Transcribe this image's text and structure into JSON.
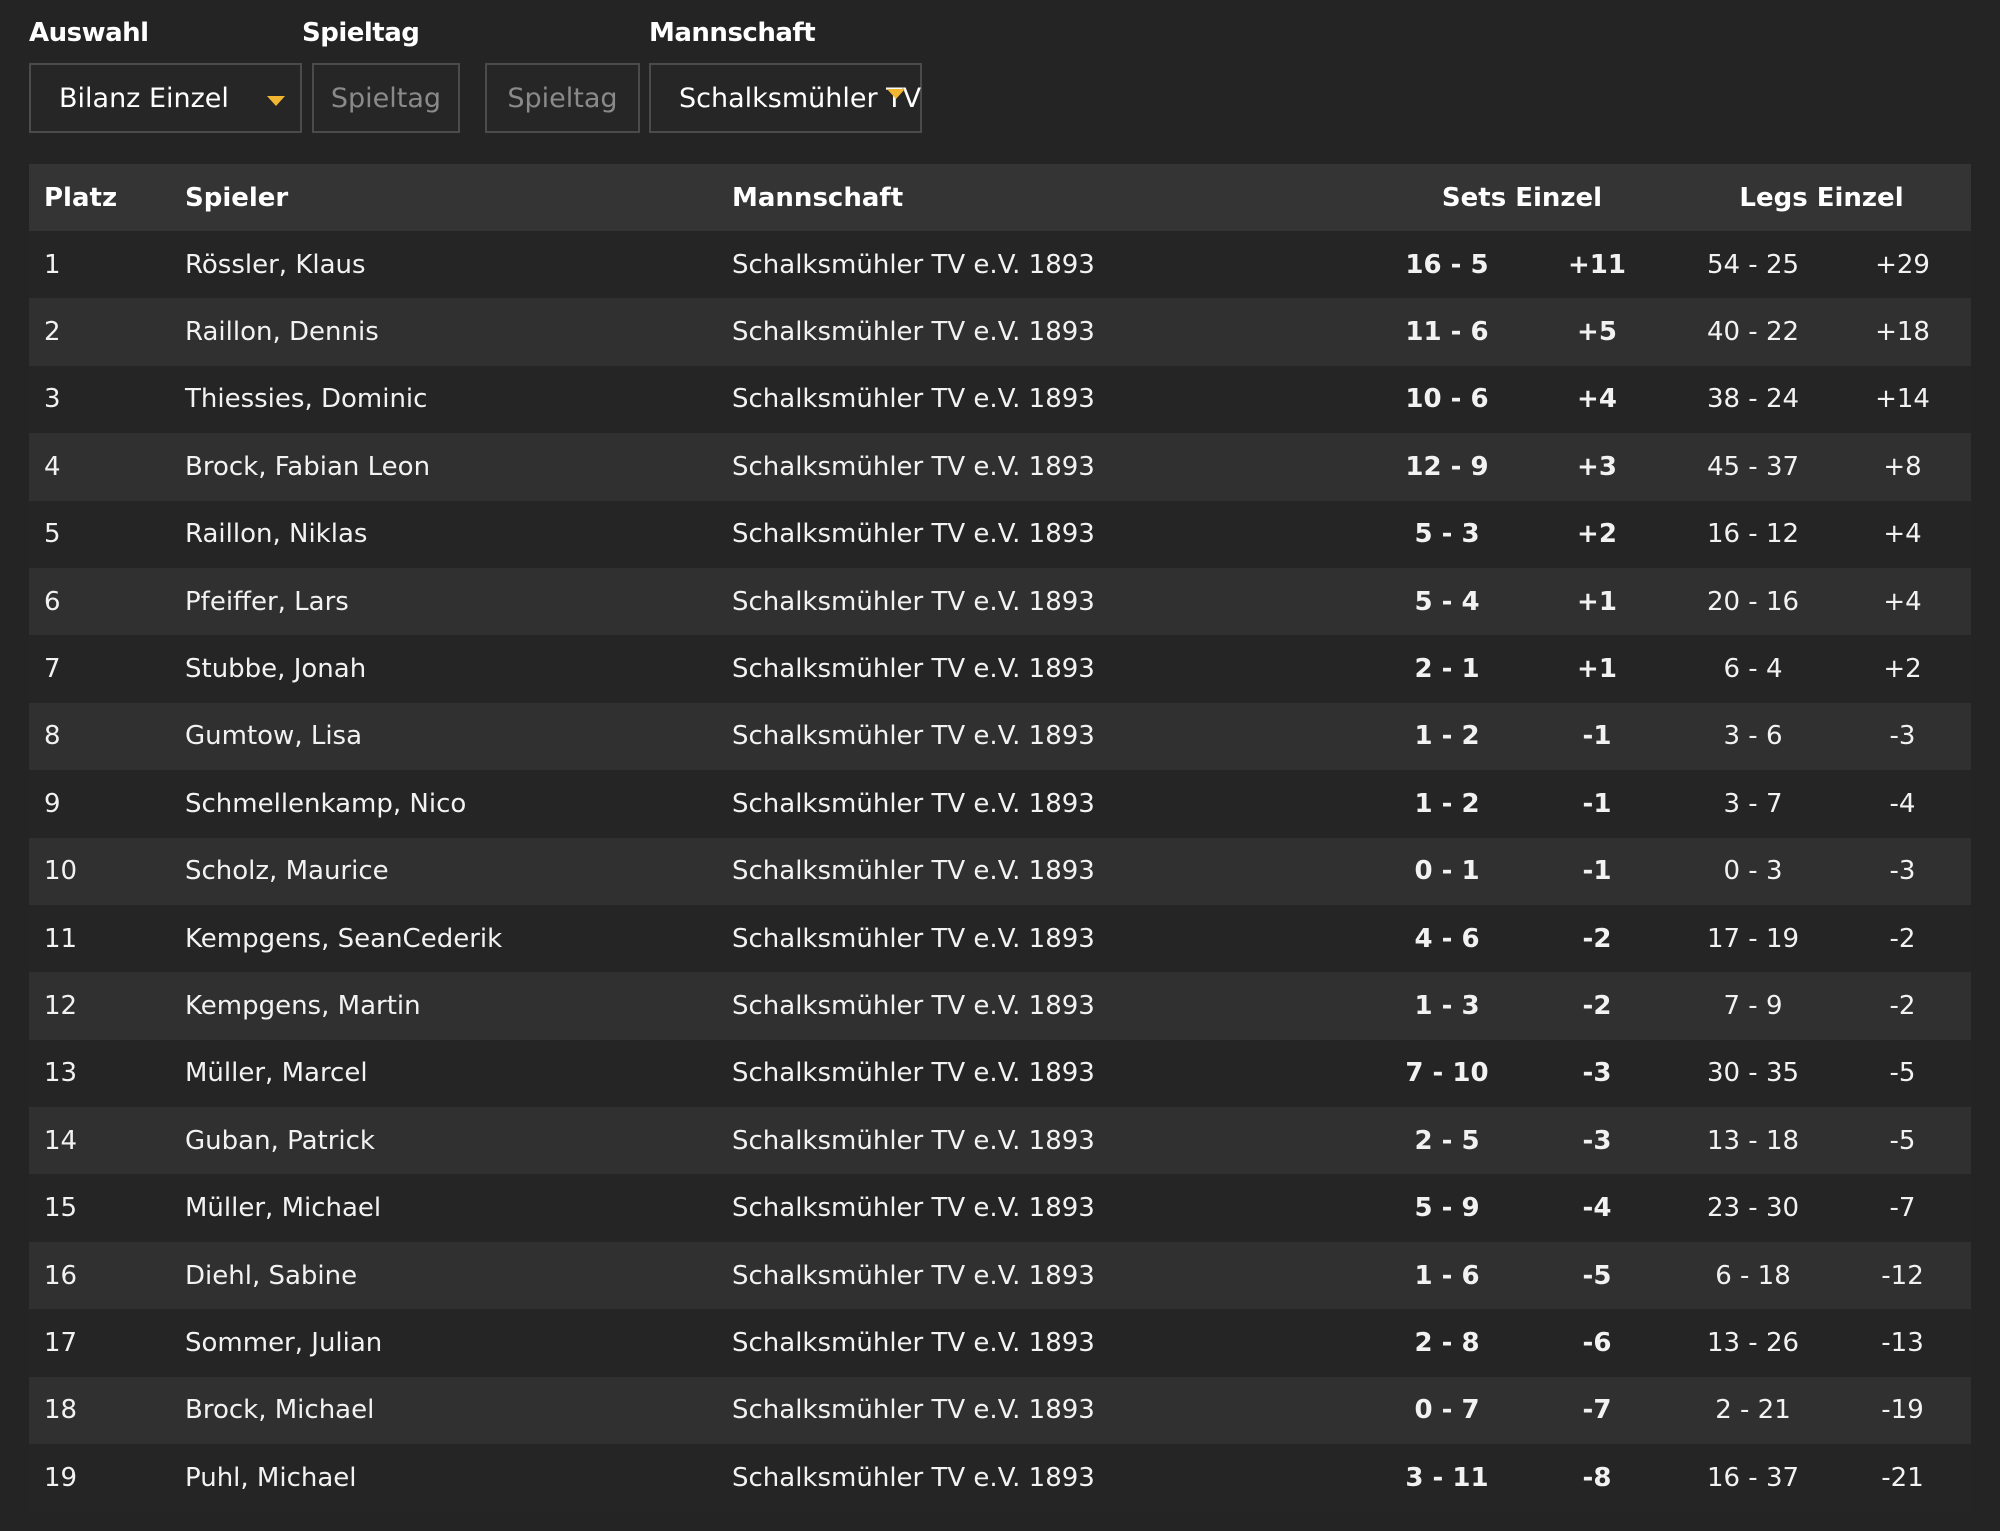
{
  "filters": {
    "auswahl_label": "Auswahl",
    "auswahl_value": "Bilanz Einzel",
    "spieltag_label": "Spieltag",
    "spieltag_from_placeholder": "Spieltag",
    "spieltag_to_placeholder": "Spieltag",
    "mannschaft_label": "Mannschaft",
    "mannschaft_value": "Schalksmühler TV"
  },
  "table": {
    "headers": {
      "platz": "Platz",
      "spieler": "Spieler",
      "mannschaft": "Mannschaft",
      "sets": "Sets Einzel",
      "legs": "Legs Einzel"
    },
    "rows": [
      {
        "platz": "1",
        "spieler": "Rössler, Klaus",
        "mannschaft": "Schalksmühler TV e.V. 1893",
        "sets": "16 - 5",
        "sets_diff": "+11",
        "legs": "54 - 25",
        "legs_diff": "+29"
      },
      {
        "platz": "2",
        "spieler": "Raillon, Dennis",
        "mannschaft": "Schalksmühler TV e.V. 1893",
        "sets": "11 - 6",
        "sets_diff": "+5",
        "legs": "40 - 22",
        "legs_diff": "+18"
      },
      {
        "platz": "3",
        "spieler": "Thiessies, Dominic",
        "mannschaft": "Schalksmühler TV e.V. 1893",
        "sets": "10 - 6",
        "sets_diff": "+4",
        "legs": "38 - 24",
        "legs_diff": "+14"
      },
      {
        "platz": "4",
        "spieler": "Brock, Fabian Leon",
        "mannschaft": "Schalksmühler TV e.V. 1893",
        "sets": "12 - 9",
        "sets_diff": "+3",
        "legs": "45 - 37",
        "legs_diff": "+8"
      },
      {
        "platz": "5",
        "spieler": "Raillon, Niklas",
        "mannschaft": "Schalksmühler TV e.V. 1893",
        "sets": "5 - 3",
        "sets_diff": "+2",
        "legs": "16 - 12",
        "legs_diff": "+4"
      },
      {
        "platz": "6",
        "spieler": "Pfeiffer, Lars",
        "mannschaft": "Schalksmühler TV e.V. 1893",
        "sets": "5 - 4",
        "sets_diff": "+1",
        "legs": "20 - 16",
        "legs_diff": "+4"
      },
      {
        "platz": "7",
        "spieler": "Stubbe, Jonah",
        "mannschaft": "Schalksmühler TV e.V. 1893",
        "sets": "2 - 1",
        "sets_diff": "+1",
        "legs": "6 - 4",
        "legs_diff": "+2"
      },
      {
        "platz": "8",
        "spieler": "Gumtow, Lisa",
        "mannschaft": "Schalksmühler TV e.V. 1893",
        "sets": "1 - 2",
        "sets_diff": "-1",
        "legs": "3 - 6",
        "legs_diff": "-3"
      },
      {
        "platz": "9",
        "spieler": "Schmellenkamp, Nico",
        "mannschaft": "Schalksmühler TV e.V. 1893",
        "sets": "1 - 2",
        "sets_diff": "-1",
        "legs": "3 - 7",
        "legs_diff": "-4"
      },
      {
        "platz": "10",
        "spieler": "Scholz, Maurice",
        "mannschaft": "Schalksmühler TV e.V. 1893",
        "sets": "0 - 1",
        "sets_diff": "-1",
        "legs": "0 - 3",
        "legs_diff": "-3"
      },
      {
        "platz": "11",
        "spieler": "Kempgens, SeanCederik",
        "mannschaft": "Schalksmühler TV e.V. 1893",
        "sets": "4 - 6",
        "sets_diff": "-2",
        "legs": "17 - 19",
        "legs_diff": "-2"
      },
      {
        "platz": "12",
        "spieler": "Kempgens, Martin",
        "mannschaft": "Schalksmühler TV e.V. 1893",
        "sets": "1 - 3",
        "sets_diff": "-2",
        "legs": "7 - 9",
        "legs_diff": "-2"
      },
      {
        "platz": "13",
        "spieler": "Müller, Marcel",
        "mannschaft": "Schalksmühler TV e.V. 1893",
        "sets": "7 - 10",
        "sets_diff": "-3",
        "legs": "30 - 35",
        "legs_diff": "-5"
      },
      {
        "platz": "14",
        "spieler": "Guban, Patrick",
        "mannschaft": "Schalksmühler TV e.V. 1893",
        "sets": "2 - 5",
        "sets_diff": "-3",
        "legs": "13 - 18",
        "legs_diff": "-5"
      },
      {
        "platz": "15",
        "spieler": "Müller, Michael",
        "mannschaft": "Schalksmühler TV e.V. 1893",
        "sets": "5 - 9",
        "sets_diff": "-4",
        "legs": "23 - 30",
        "legs_diff": "-7"
      },
      {
        "platz": "16",
        "spieler": "Diehl, Sabine",
        "mannschaft": "Schalksmühler TV e.V. 1893",
        "sets": "1 - 6",
        "sets_diff": "-5",
        "legs": "6 - 18",
        "legs_diff": "-12"
      },
      {
        "platz": "17",
        "spieler": "Sommer, Julian",
        "mannschaft": "Schalksmühler TV e.V. 1893",
        "sets": "2 - 8",
        "sets_diff": "-6",
        "legs": "13 - 26",
        "legs_diff": "-13"
      },
      {
        "platz": "18",
        "spieler": "Brock, Michael",
        "mannschaft": "Schalksmühler TV e.V. 1893",
        "sets": "0 - 7",
        "sets_diff": "-7",
        "legs": "2 - 21",
        "legs_diff": "-19"
      },
      {
        "platz": "19",
        "spieler": "Puhl, Michael",
        "mannschaft": "Schalksmühler TV e.V. 1893",
        "sets": "3 - 11",
        "sets_diff": "-8",
        "legs": "16 - 37",
        "legs_diff": "-21"
      }
    ]
  },
  "colors": {
    "background": "#242424",
    "header_row": "#343434",
    "row_even": "#303030",
    "accent_caret": "#f2b632"
  },
  "icons": {
    "dropdown": "caret-down-icon"
  }
}
